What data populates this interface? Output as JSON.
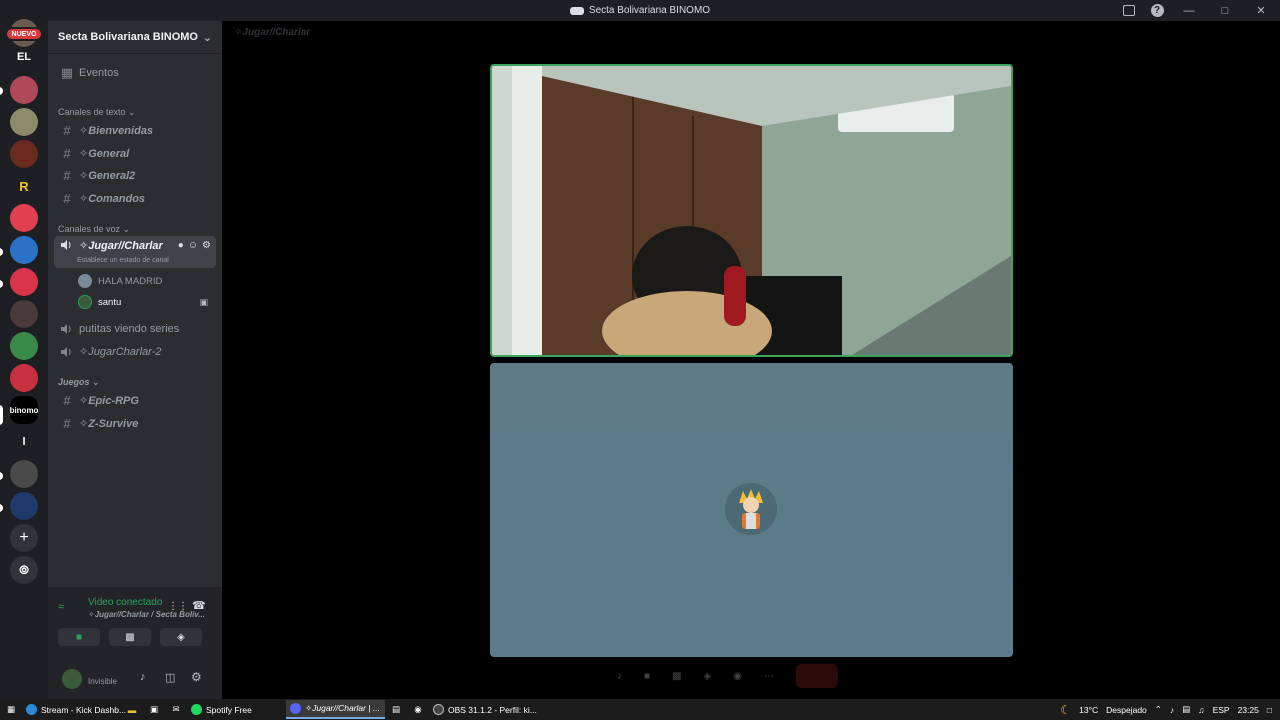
{
  "window": {
    "title": "Secta Bolivariana BINOMO"
  },
  "servers": {
    "new_badge": "NUEVO",
    "el_label": "EL",
    "r_label": "R",
    "binomo_label": "binomo",
    "l_label": "l"
  },
  "guild": {
    "name": "Secta Bolivariana BINOMO",
    "events": "Eventos",
    "text_category": "Canales de texto",
    "text_channels": [
      "✧Bienvenidas",
      "✧General",
      "✧General2",
      "✧Comandos"
    ],
    "voice_category": "Canales de voz",
    "active_voice": "✧Jugar//Charlar",
    "channel_status": "Establece un estado de canal",
    "voice_users": [
      "HALA MADRID",
      "santu"
    ],
    "voice_other": [
      "putitas viendo series",
      "✧JugarCharlar-2"
    ],
    "games_category": "Juegos",
    "game_channels": [
      "✧Epic-RPG",
      "✧Z-Survive"
    ]
  },
  "voice_panel": {
    "status": "Video conectado",
    "location": "✧Jugar//Charlar / Secta Boliv..."
  },
  "user_bar": {
    "status": "Invisible"
  },
  "main": {
    "channel_title": "✧Jugar//Charlar"
  },
  "taskbar": {
    "tasks": [
      "Stream - Kick Dashb...",
      "Spotify Free",
      "✧Jugar//Charlar | ...",
      "OBS 31.1.2 - Perfil: ki..."
    ],
    "weather_temp": "13°C",
    "weather_desc": "Despejado",
    "lang": "ESP",
    "time": "23:25"
  },
  "colors": {
    "accent_green": "#23a55a",
    "background": "#2b2d31",
    "danger": "#da373c"
  }
}
